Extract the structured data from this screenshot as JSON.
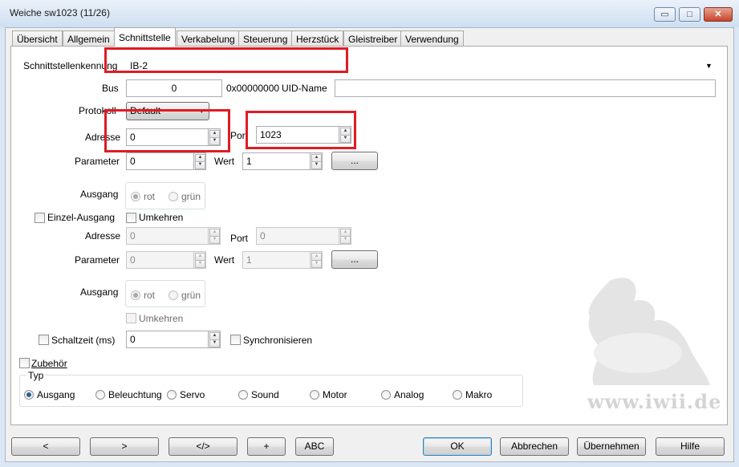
{
  "window": {
    "title": "Weiche sw1023 (11/26)",
    "controls": {
      "minimize": "▭",
      "maximize": "□",
      "close": "✕"
    }
  },
  "tabs": [
    {
      "label": "Übersicht"
    },
    {
      "label": "Allgemein"
    },
    {
      "label": "Schnittstelle",
      "active": true
    },
    {
      "label": "Verkabelung"
    },
    {
      "label": "Steuerung"
    },
    {
      "label": "Herzstück"
    },
    {
      "label": "Gleistreiber"
    },
    {
      "label": "Verwendung"
    }
  ],
  "interface": {
    "id_label": "Schnittstellenkennung",
    "id_value": "IB-2",
    "bus_label": "Bus",
    "bus_value": "0",
    "bus_hex": "0x00000000",
    "uid_label": "UID-Name",
    "uid_value": "",
    "protocol_label": "Protokoll",
    "protocol_value": "Default",
    "address_label": "Adresse",
    "address_value": "0",
    "port_label": "Port",
    "port_value": "1023",
    "param_label": "Parameter",
    "param_value": "0",
    "value_label": "Wert",
    "value_value": "1",
    "ellipsis_label": "...",
    "output_label": "Ausgang",
    "output_options": [
      "rot",
      "grün"
    ]
  },
  "single_output": {
    "checkbox_label": "Einzel-Ausgang",
    "invert_label": "Umkehren",
    "address_label": "Adresse",
    "address_value": "0",
    "port_label": "Port",
    "port_value": "0",
    "param_label": "Parameter",
    "param_value": "0",
    "value_label": "Wert",
    "value_value": "1",
    "ellipsis_label": "...",
    "output_label": "Ausgang",
    "output_options": [
      "rot",
      "grün"
    ],
    "invert2_label": "Umkehren"
  },
  "switch_time": {
    "checkbox_label": "Schaltzeit (ms)",
    "value": "0",
    "sync_label": "Synchronisieren"
  },
  "accessory": {
    "checkbox_label": "Zubehör",
    "type_label": "Typ",
    "types": [
      "Ausgang",
      "Beleuchtung",
      "Servo",
      "Sound",
      "Motor",
      "Analog",
      "Makro"
    ],
    "selected": "Ausgang"
  },
  "watermark": {
    "text": "www.iwii.de"
  },
  "footer": {
    "prev": "<",
    "next": ">",
    "code": "</>",
    "plus": "+",
    "abc": "ABC",
    "ok": "OK",
    "cancel": "Abbrechen",
    "apply": "Übernehmen",
    "help": "Hilfe"
  },
  "colors": {
    "highlight_box": "#e01b24",
    "accent": "#2c5e9e"
  }
}
